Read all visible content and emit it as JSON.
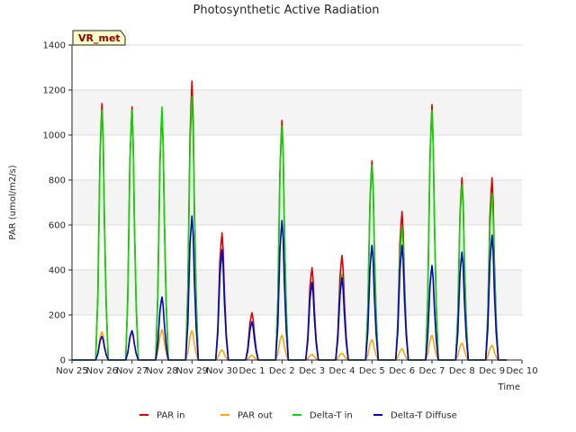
{
  "chart_data": {
    "type": "line",
    "title": "Photosynthetic Active Radiation",
    "xlabel": "Time",
    "ylabel": "PAR (umol/m2/s)",
    "ylim": [
      0,
      1400
    ],
    "yticks": [
      0,
      200,
      400,
      600,
      800,
      1000,
      1200,
      1400
    ],
    "x_range": [
      "2024-11-25",
      "2024-12-10"
    ],
    "xtick_labels": [
      "Nov 25",
      "Nov 26",
      "Nov 27",
      "Nov 28",
      "Nov 29",
      "Nov 30",
      "Dec 1",
      "Dec 2",
      "Dec 3",
      "Dec 4",
      "Dec 5",
      "Dec 6",
      "Dec 7",
      "Dec 8",
      "Dec 9",
      "Dec 10"
    ],
    "annotation": "VR_met",
    "background_bands": true,
    "legend_position": "bottom-center",
    "series": [
      {
        "name": "PAR in",
        "color": "#dd0000",
        "daily_peaks": [
          {
            "date": "2024-11-25",
            "value": 1140
          },
          {
            "date": "2024-11-26",
            "value": 1125
          },
          {
            "date": "2024-11-27",
            "value": 1105
          },
          {
            "date": "2024-11-28",
            "value": 1240
          },
          {
            "date": "2024-11-29",
            "value": 565
          },
          {
            "date": "2024-11-30",
            "value": 210
          },
          {
            "date": "2024-12-01",
            "value": 1065
          },
          {
            "date": "2024-12-02",
            "value": 410
          },
          {
            "date": "2024-12-03",
            "value": 465
          },
          {
            "date": "2024-12-04",
            "value": 885
          },
          {
            "date": "2024-12-05",
            "value": 660
          },
          {
            "date": "2024-12-06",
            "value": 1135
          },
          {
            "date": "2024-12-07",
            "value": 810
          },
          {
            "date": "2024-12-08",
            "value": 810
          }
        ]
      },
      {
        "name": "PAR out",
        "color": "#ffa500",
        "daily_peaks": [
          {
            "date": "2024-11-25",
            "value": 125
          },
          {
            "date": "2024-11-26",
            "value": 120
          },
          {
            "date": "2024-11-27",
            "value": 135
          },
          {
            "date": "2024-11-28",
            "value": 130
          },
          {
            "date": "2024-11-29",
            "value": 45
          },
          {
            "date": "2024-11-30",
            "value": 20
          },
          {
            "date": "2024-12-01",
            "value": 110
          },
          {
            "date": "2024-12-02",
            "value": 25
          },
          {
            "date": "2024-12-03",
            "value": 30
          },
          {
            "date": "2024-12-04",
            "value": 90
          },
          {
            "date": "2024-12-05",
            "value": 50
          },
          {
            "date": "2024-12-06",
            "value": 110
          },
          {
            "date": "2024-12-07",
            "value": 75
          },
          {
            "date": "2024-12-08",
            "value": 65
          }
        ]
      },
      {
        "name": "Delta-T in",
        "color": "#00dd00",
        "daily_peaks": [
          {
            "date": "2024-11-25",
            "value": 1110
          },
          {
            "date": "2024-11-26",
            "value": 1110
          },
          {
            "date": "2024-11-27",
            "value": 1125
          },
          {
            "date": "2024-11-28",
            "value": 1170
          },
          {
            "date": "2024-11-29",
            "value": 480
          },
          {
            "date": "2024-11-30",
            "value": 170
          },
          {
            "date": "2024-12-01",
            "value": 1040
          },
          {
            "date": "2024-12-02",
            "value": 345
          },
          {
            "date": "2024-12-03",
            "value": 380
          },
          {
            "date": "2024-12-04",
            "value": 865
          },
          {
            "date": "2024-12-05",
            "value": 590
          },
          {
            "date": "2024-12-06",
            "value": 1110
          },
          {
            "date": "2024-12-07",
            "value": 780
          },
          {
            "date": "2024-12-08",
            "value": 740
          }
        ]
      },
      {
        "name": "Delta-T Diffuse",
        "color": "#0000cc",
        "daily_peaks": [
          {
            "date": "2024-11-25",
            "value": 105
          },
          {
            "date": "2024-11-26",
            "value": 130
          },
          {
            "date": "2024-11-27",
            "value": 280
          },
          {
            "date": "2024-11-28",
            "value": 640
          },
          {
            "date": "2024-11-29",
            "value": 490
          },
          {
            "date": "2024-11-30",
            "value": 170
          },
          {
            "date": "2024-12-01",
            "value": 620
          },
          {
            "date": "2024-12-02",
            "value": 345
          },
          {
            "date": "2024-12-03",
            "value": 365
          },
          {
            "date": "2024-12-04",
            "value": 510
          },
          {
            "date": "2024-12-05",
            "value": 510
          },
          {
            "date": "2024-12-06",
            "value": 420
          },
          {
            "date": "2024-12-07",
            "value": 480
          },
          {
            "date": "2024-12-08",
            "value": 555
          }
        ]
      }
    ]
  }
}
